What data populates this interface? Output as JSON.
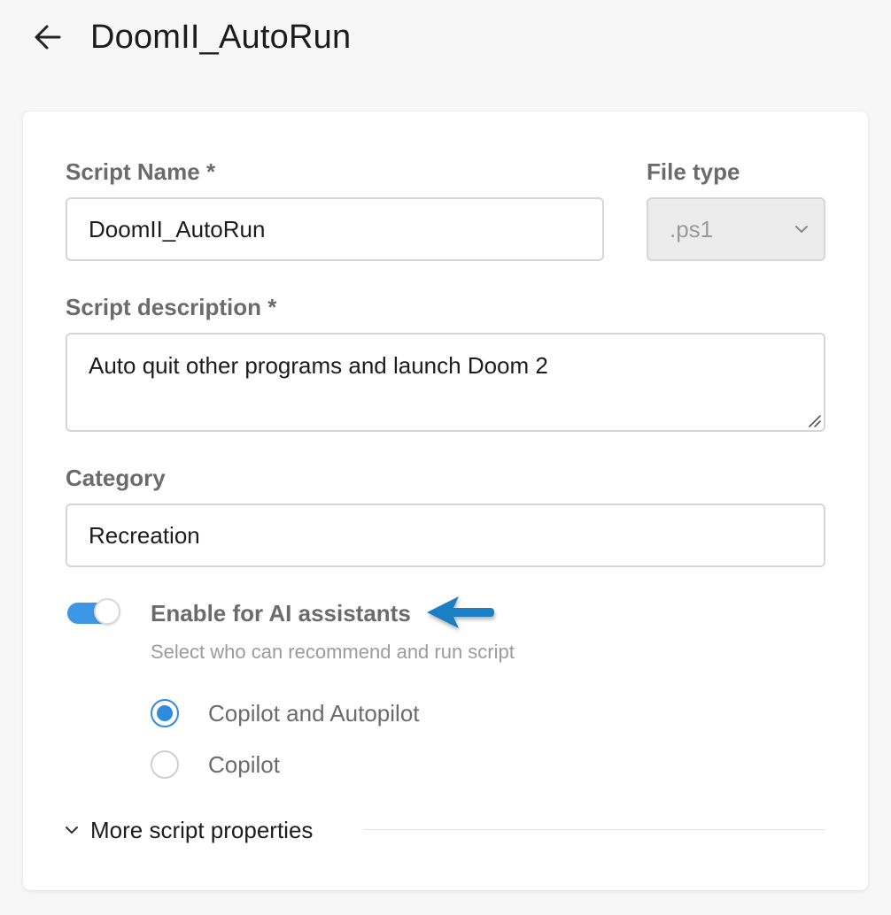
{
  "header": {
    "back_icon": "arrow-left-icon",
    "title": "DoomII_AutoRun"
  },
  "form": {
    "script_name": {
      "label": "Script Name *",
      "value": "DoomII_AutoRun"
    },
    "file_type": {
      "label": "File type",
      "value": ".ps1",
      "icon": "chevron-down-icon"
    },
    "description": {
      "label": "Script description *",
      "value": "Auto quit other programs and launch Doom 2"
    },
    "category": {
      "label": "Category",
      "value": "Recreation"
    },
    "ai": {
      "enabled": true,
      "title": "Enable for AI assistants",
      "subtitle": "Select who can recommend and run script",
      "options": [
        {
          "label": "Copilot and Autopilot",
          "selected": true
        },
        {
          "label": "Copilot",
          "selected": false
        }
      ]
    },
    "more_properties": {
      "label": "More script properties",
      "icon": "chevron-down-icon"
    }
  },
  "colors": {
    "accent": "#2f8be0",
    "toggle_track": "#3d97e6",
    "annotation_arrow": "#1f7fc4",
    "label_gray": "#6b6b6b",
    "background": "#f7f7f7"
  }
}
